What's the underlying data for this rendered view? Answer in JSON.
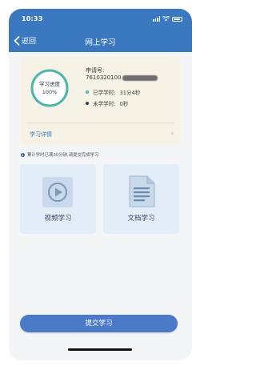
{
  "status_bar": {
    "time": "10:33"
  },
  "nav": {
    "back_label": "返回",
    "title": "网上学习"
  },
  "progress_card": {
    "ring_label": "学习进度",
    "ring_value": "100%",
    "progress_fraction": 1.0,
    "application_label": "申请号:",
    "application_number": "7610320100",
    "studied_label": "已学学时:",
    "studied_value": "31分4秒",
    "unstudied_label": "未学学时:",
    "unstudied_value": "0秒",
    "detail_label": "学习详情"
  },
  "notice": "累计学时已满30分钟,请提交完成学习",
  "tiles": {
    "video": "视频学习",
    "document": "文档学习"
  },
  "submit_label": "提交学习",
  "colors": {
    "header_blue": "#3a79bf",
    "ring_teal": "#4cb6ad",
    "studied_dot": "#4cb6ad",
    "unstudied_dot": "#2c3e50",
    "submit_blue": "#4a7ac8",
    "card_bg": "#f7f2e6",
    "tile_bg": "#e3edf7"
  }
}
